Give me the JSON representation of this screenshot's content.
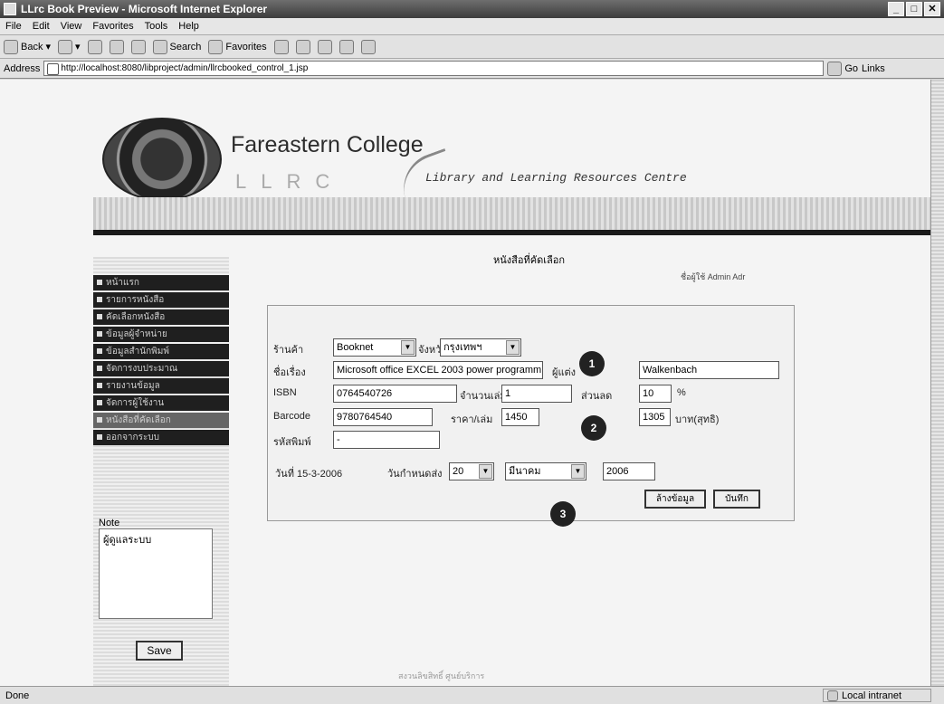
{
  "window": {
    "title": "LLrc Book Preview - Microsoft Internet Explorer"
  },
  "menu": [
    "File",
    "Edit",
    "View",
    "Favorites",
    "Tools",
    "Help"
  ],
  "toolbar": {
    "back": "Back",
    "search": "Search",
    "favorites": "Favorites"
  },
  "address": {
    "label": "Address",
    "url": "http://localhost:8080/libproject/admin/llrcbooked_control_1.jsp",
    "go": "Go",
    "links": "Links"
  },
  "header": {
    "college": "Fareastern College",
    "llrc": "LLRC",
    "tagline": "Library and Learning Resources Centre"
  },
  "page": {
    "title": "หนังสือที่คัดเลือก",
    "user": "ชื่อผู้ใช้ Admin Adr"
  },
  "sidebar": {
    "items": [
      "หน้าแรก",
      "รายการหนังสือ",
      "คัดเลือกหนังสือ",
      "ข้อมูลผู้จำหน่าย",
      "ข้อมูลสำนักพิมพ์",
      "จัดการงบประมาณ",
      "รายงานข้อมูล",
      "จัดการผู้ใช้งาน",
      "หนังสือที่คัดเลือก",
      "ออกจากระบบ"
    ],
    "note_label": "Note",
    "note_text": "ผู้ดูแลระบบ",
    "save_label": "Save"
  },
  "form": {
    "label_supplier": "ร้านค้า",
    "supplier": "Booknet",
    "label_province": "จังหวัด",
    "province": "กรุงเทพฯ",
    "label_title": "ชื่อเรื่อง",
    "title": "Microsoft office EXCEL 2003 power programm",
    "label_author": "ผู้แต่ง",
    "author": "Walkenbach",
    "label_isbn": "ISBN",
    "isbn": "0764540726",
    "label_qty": "จำนวนเล่ม",
    "qty": "1",
    "label_discount": "ส่วนลด",
    "discount": "10",
    "percent": "%",
    "label_barcode": "Barcode",
    "barcode": "9780764540",
    "label_price": "ราคา/เล่ม",
    "price": "1450",
    "net": "1305",
    "baht": "บาท(สุทธิ)",
    "label_code": "รหัสพิมพ์",
    "code": "-",
    "label_date": "วันที่ 15-3-2006",
    "label_due": "วันกำหนดส่ง",
    "due_day": "20",
    "due_month": "มีนาคม",
    "due_year": "2006",
    "clear_label": "ล้างข้อมูล",
    "save_label": "บันทึก"
  },
  "callouts": [
    "1",
    "2",
    "3"
  ],
  "footer": "สงวนลิขสิทธิ์ ศูนย์บริการ",
  "status": {
    "left": "Done",
    "zone": "Local intranet"
  }
}
